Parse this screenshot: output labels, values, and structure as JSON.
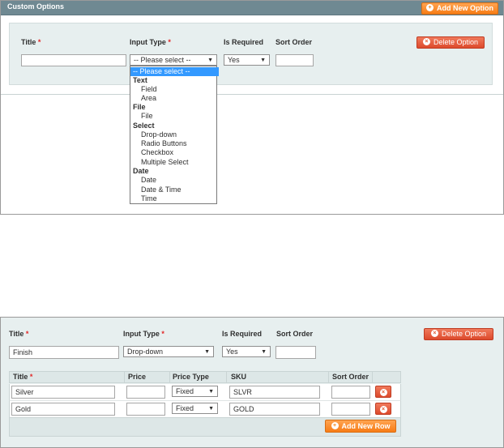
{
  "top": {
    "header_title": "Custom Options",
    "add_new_option": "Add New Option",
    "delete_option": "Delete Option",
    "labels": {
      "title": "Title",
      "input_type": "Input Type",
      "is_required": "Is Required",
      "sort_order": "Sort Order",
      "required_mark": "*"
    },
    "title_value": "",
    "input_type_value": "-- Please select --",
    "is_required_value": "Yes",
    "sort_order_value": "",
    "dropdown": [
      {
        "kind": "highlight",
        "label": "-- Please select --"
      },
      {
        "kind": "group",
        "label": "Text"
      },
      {
        "kind": "option",
        "label": "Field"
      },
      {
        "kind": "option",
        "label": "Area"
      },
      {
        "kind": "group",
        "label": "File"
      },
      {
        "kind": "option",
        "label": "File"
      },
      {
        "kind": "group",
        "label": "Select"
      },
      {
        "kind": "option",
        "label": "Drop-down"
      },
      {
        "kind": "option",
        "label": "Radio Buttons"
      },
      {
        "kind": "option",
        "label": "Checkbox"
      },
      {
        "kind": "option",
        "label": "Multiple Select"
      },
      {
        "kind": "group",
        "label": "Date"
      },
      {
        "kind": "option",
        "label": "Date"
      },
      {
        "kind": "option",
        "label": "Date & Time"
      },
      {
        "kind": "option",
        "label": "Time"
      }
    ]
  },
  "bottom": {
    "labels": {
      "title": "Title",
      "input_type": "Input Type",
      "is_required": "Is Required",
      "sort_order": "Sort Order",
      "required_mark": "*"
    },
    "title_value": "Finish",
    "input_type_value": "Drop-down",
    "is_required_value": "Yes",
    "sort_order_value": "",
    "delete_option": "Delete Option",
    "grid": {
      "headers": {
        "title": "Title",
        "price": "Price",
        "price_type": "Price Type",
        "sku": "SKU",
        "sort_order": "Sort Order"
      },
      "rows": [
        {
          "title": "Silver",
          "price": "",
          "price_type": "Fixed",
          "sku": "SLVR",
          "sort_order": ""
        },
        {
          "title": "Gold",
          "price": "",
          "price_type": "Fixed",
          "sku": "GOLD",
          "sort_order": ""
        }
      ],
      "add_new_row": "Add New Row"
    }
  },
  "icons": {
    "add": "plus-circle-icon",
    "delete": "x-circle-icon",
    "dropdown": "triangle-down-icon"
  },
  "colors": {
    "header_bg": "#6f8992",
    "orange_button": "#f68619",
    "red_button": "#e2572f",
    "panel_bg": "#e7efef",
    "select_highlight": "#3399ff"
  }
}
